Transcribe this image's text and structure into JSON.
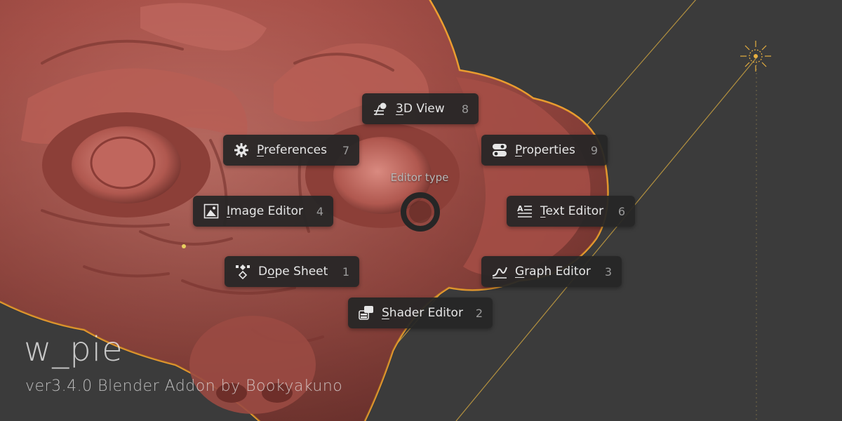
{
  "pie_menu": {
    "title": "Editor type",
    "items": [
      {
        "key": "3d_view",
        "label_u": "3",
        "label_rest": "D View",
        "number": "8",
        "icon": "3d-view-icon"
      },
      {
        "key": "preferences",
        "label_u": "P",
        "label_rest": "references",
        "number": "7",
        "icon": "gear-icon"
      },
      {
        "key": "properties",
        "label_u": "P",
        "label_rest": "roperties",
        "number": "9",
        "icon": "properties-icon"
      },
      {
        "key": "image_editor",
        "label_u": "I",
        "label_rest": "mage Editor",
        "number": "4",
        "icon": "image-icon"
      },
      {
        "key": "text_editor",
        "label_u": "T",
        "label_rest": "ext Editor",
        "number": "6",
        "icon": "text-editor-icon"
      },
      {
        "key": "dope_sheet",
        "label_pre": "D",
        "label_u": "o",
        "label_rest": "pe Sheet",
        "number": "1",
        "icon": "dope-sheet-icon"
      },
      {
        "key": "graph_editor",
        "label_u": "G",
        "label_rest": "raph Editor",
        "number": "3",
        "icon": "graph-editor-icon"
      },
      {
        "key": "shader_editor",
        "label_u": "S",
        "label_rest": "hader Editor",
        "number": "2",
        "icon": "shader-editor-icon"
      }
    ]
  },
  "watermark": {
    "title": "w_pie",
    "subtitle": "ver3.4.0 Blender Addon  by Bookyakuno"
  },
  "colors": {
    "background": "#3b3b3b",
    "mesh": "#a8524a",
    "selection_outline": "#f0a030",
    "menu_bg": "#262626",
    "menu_text": "#e6e6e6"
  }
}
